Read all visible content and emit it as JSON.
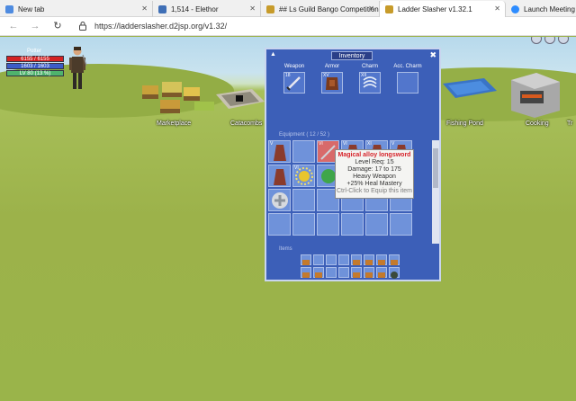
{
  "browser": {
    "tabs": [
      {
        "label": "New tab",
        "active": false,
        "color": "#4e8be0"
      },
      {
        "label": "1,514 - Elethor",
        "active": false,
        "color": "#3f6fb6"
      },
      {
        "label": "## Ls Guild Bango Competition",
        "active": false,
        "color": "#c79b2a"
      },
      {
        "label": "Ladder Slasher v1.32.1",
        "active": true,
        "color": "#c79b2a"
      },
      {
        "label": "Launch Meeting - Zo",
        "active": false,
        "color": "#2d8cff"
      }
    ],
    "url": "https://ladderslasher.d2jsp.org/v1.32/"
  },
  "hud": {
    "name": "Potter",
    "hp": "6155 / 6155",
    "mp": "1603 / 1603",
    "xp": "LV 80 (13 %)",
    "colors": {
      "hp": "#d32222",
      "mp": "#3c5cc8",
      "xp": "#4fb36d"
    }
  },
  "buildings": {
    "marketplace": "Marketplace",
    "catacombs": "Catacombs",
    "fishing_pond": "Fishing Pond",
    "cooking": "Cooking",
    "tr": "Tr"
  },
  "inventory": {
    "title": "Inventory",
    "slots": [
      {
        "label": "Weapon",
        "level": "18"
      },
      {
        "label": "Armor",
        "level": "XV"
      },
      {
        "label": "Charm",
        "level": "XII"
      },
      {
        "label": "Acc. Charm",
        "level": ""
      }
    ],
    "equipment_label": "Equipment ( 12 / 52 )",
    "items_label": "Items",
    "grid_levels": [
      "V",
      "",
      "VI",
      "VI",
      "XI",
      "V",
      "",
      "VI",
      "",
      "VI",
      "",
      "",
      "",
      "",
      "",
      ""
    ]
  },
  "tooltip": {
    "name": "Magical alloy longsword",
    "level_req": "Level Req: 15",
    "damage": "Damage: 17 to 175",
    "type": "Heavy Weapon",
    "bonus": "+25% Heal Mastery",
    "hint": "Ctrl-Click to Equip this item"
  }
}
